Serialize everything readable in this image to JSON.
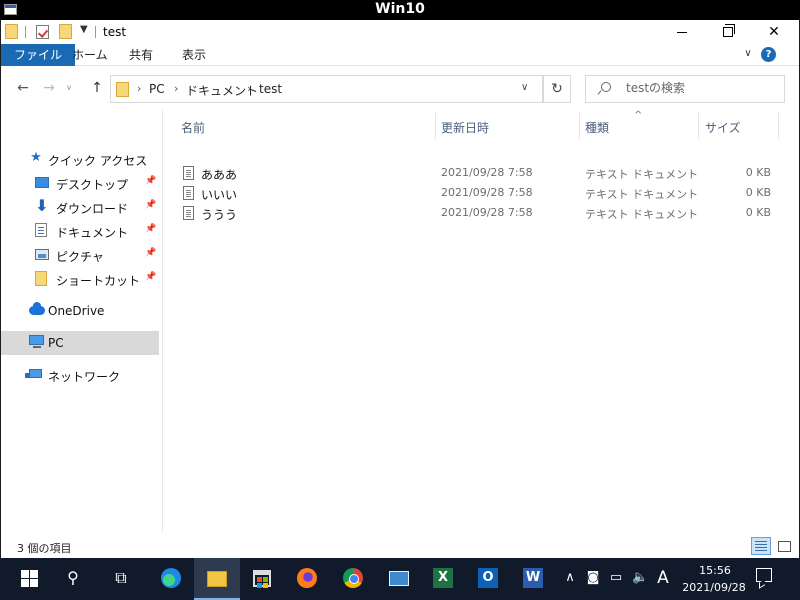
{
  "vm": {
    "title": "Win10"
  },
  "window": {
    "title": "test",
    "ribbon": {
      "tabs": [
        "ファイル",
        "ホーム",
        "共有",
        "表示"
      ],
      "help": "?"
    },
    "address": {
      "crumbs": [
        "PC",
        "ドキュメント",
        "test"
      ]
    },
    "search": {
      "placeholder": "testの検索"
    },
    "sidebar": {
      "quick_access": "クイック アクセス",
      "items": [
        "デスクトップ",
        "ダウンロード",
        "ドキュメント",
        "ピクチャ",
        "ショートカット"
      ],
      "onedrive": "OneDrive",
      "pc": "PC",
      "network": "ネットワーク"
    },
    "columns": {
      "name": "名前",
      "date": "更新日時",
      "type": "種類",
      "size": "サイズ"
    },
    "files": [
      {
        "name": "あああ",
        "date": "2021/09/28 7:58",
        "type": "テキスト ドキュメント",
        "size": "0 KB"
      },
      {
        "name": "いいい",
        "date": "2021/09/28 7:58",
        "type": "テキスト ドキュメント",
        "size": "0 KB"
      },
      {
        "name": "ううう",
        "date": "2021/09/28 7:58",
        "type": "テキスト ドキュメント",
        "size": "0 KB"
      }
    ],
    "status": "3 個の項目"
  },
  "taskbar": {
    "ime": "A",
    "apps": {
      "excel": "X",
      "outlook": "O",
      "word": "W"
    },
    "clock": {
      "time": "15:56",
      "date": "2021/09/28"
    }
  }
}
